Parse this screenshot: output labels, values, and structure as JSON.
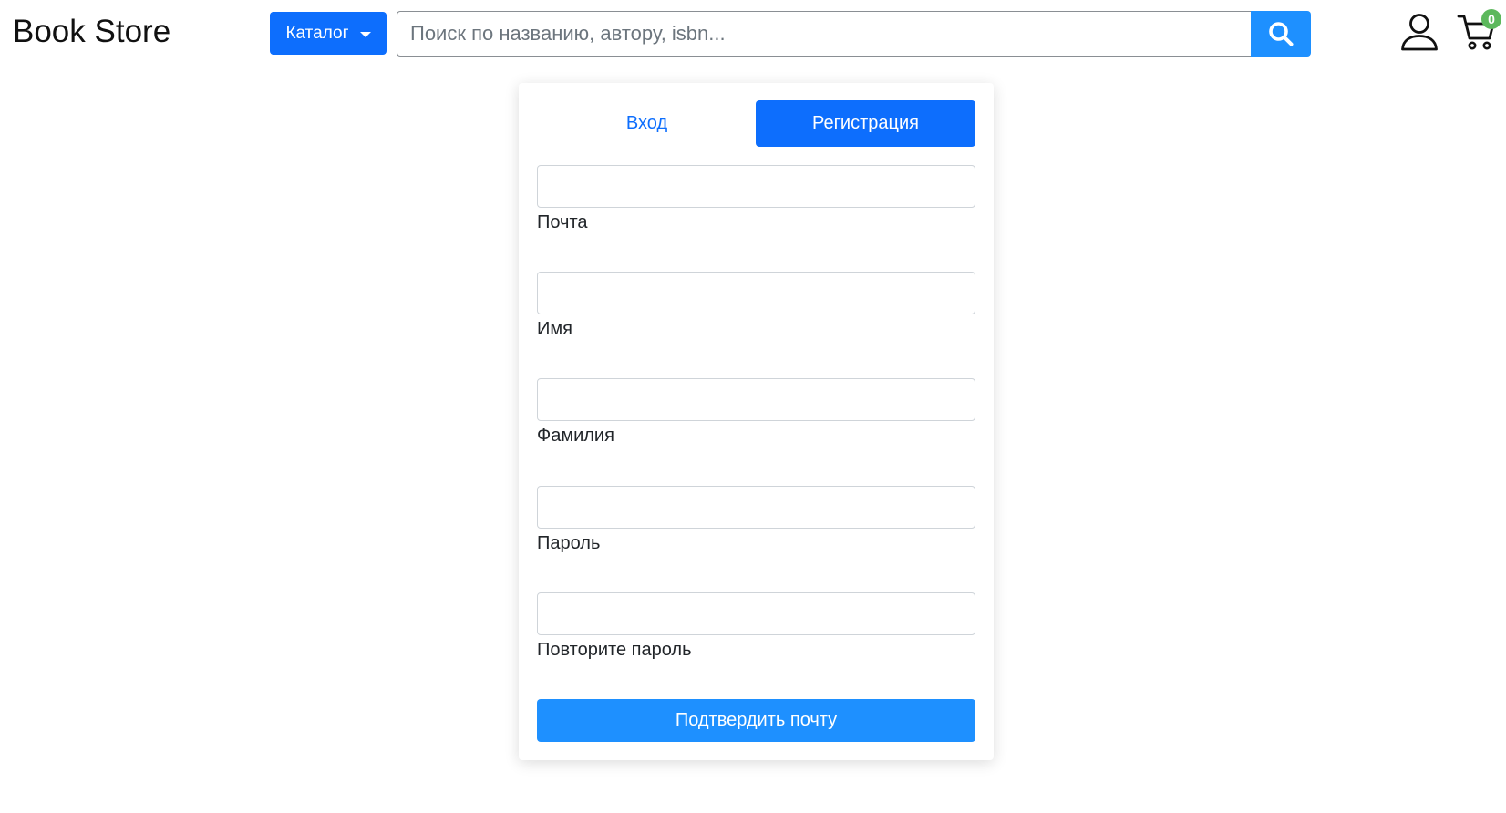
{
  "header": {
    "logo": "Book Store",
    "catalog_label": "Каталог",
    "search_placeholder": "Поиск по названию, автору, isbn...",
    "search_value": "",
    "cart_count": "0"
  },
  "auth": {
    "tabs": {
      "login": "Вход",
      "register": "Регистрация"
    },
    "active_tab": "register",
    "fields": {
      "email": {
        "label": "Почта",
        "value": ""
      },
      "first_name": {
        "label": "Имя",
        "value": ""
      },
      "last_name": {
        "label": "Фамилия",
        "value": ""
      },
      "password": {
        "label": "Пароль",
        "value": ""
      },
      "password_repeat": {
        "label": "Повторите пароль",
        "value": ""
      }
    },
    "submit_label": "Подтвердить почту"
  },
  "colors": {
    "primary": "#0d6efd",
    "submit": "#1e90ff",
    "badge": "#5cb85c"
  },
  "icons": {
    "search": "search-icon",
    "user": "user-icon",
    "cart": "cart-icon",
    "caret": "caret-down-icon"
  }
}
